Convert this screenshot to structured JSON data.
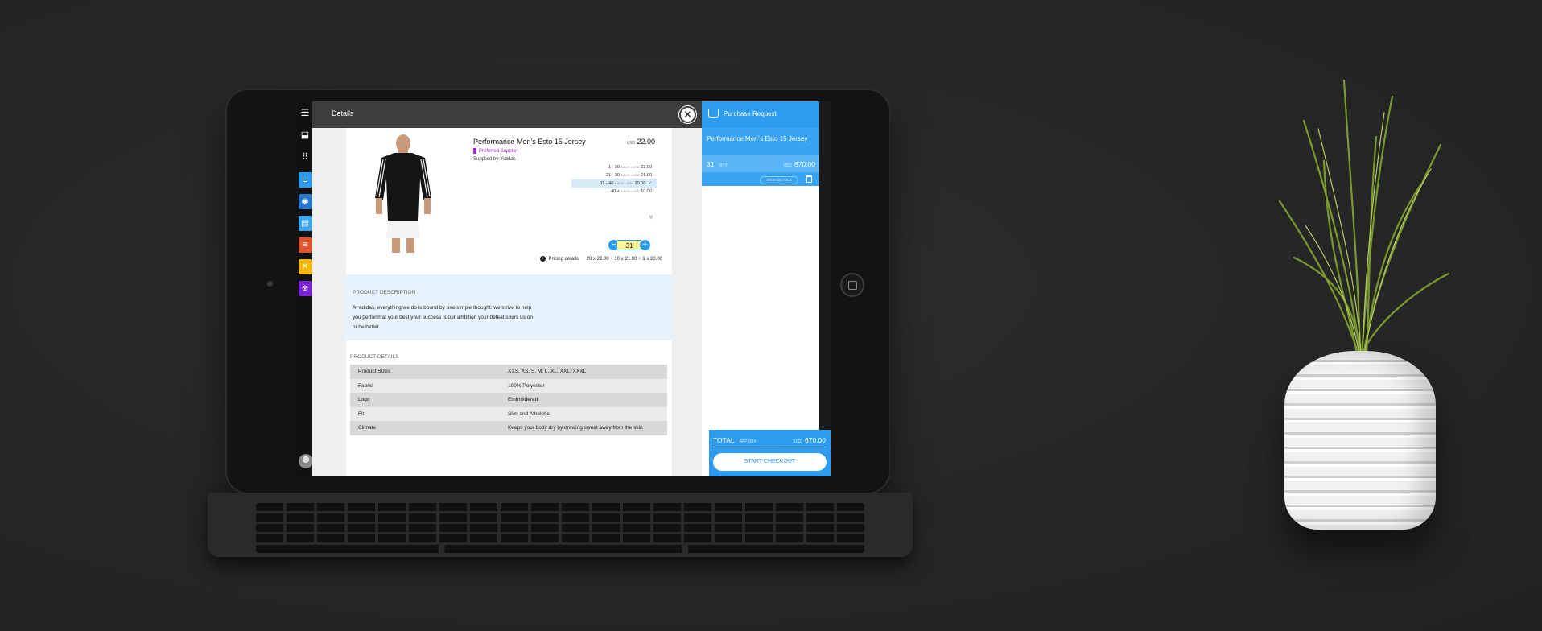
{
  "header": {
    "title": "Details"
  },
  "rail": {
    "items": [
      {
        "name": "menu-icon",
        "color": "#111111",
        "glyph": "☰"
      },
      {
        "name": "inbox-icon",
        "color": "#111111",
        "glyph": "⬓"
      },
      {
        "name": "apps-grid-icon",
        "color": "#111111",
        "glyph": "⠿"
      },
      {
        "name": "cart-icon",
        "color": "#2d9cf0",
        "glyph": "🛒"
      },
      {
        "name": "globe-icon",
        "color": "#2577c9",
        "glyph": "◉"
      },
      {
        "name": "document-icon",
        "color": "#3aa7f2",
        "glyph": "▤"
      },
      {
        "name": "layers-icon",
        "color": "#e0532c",
        "glyph": "≋"
      },
      {
        "name": "tools-icon",
        "color": "#f5b800",
        "glyph": "✕"
      },
      {
        "name": "target-icon",
        "color": "#7b22d6",
        "glyph": "⊕"
      }
    ]
  },
  "product": {
    "title": "Performance Men's Esto 15 Jersey",
    "preferred": "Preferred Supplier",
    "supplied_by": "Supplied by: Adidas",
    "price_currency": "USD",
    "price": "22.00",
    "tiers": [
      {
        "range": "1 - 20",
        "unit": "EACH • USD",
        "price": "22.00",
        "selected": false
      },
      {
        "range": "21 - 30",
        "unit": "EACH • USD",
        "price": "21.00",
        "selected": false
      },
      {
        "range": "31 - 40",
        "unit": "EACH • USD",
        "price": "20.00",
        "selected": true
      },
      {
        "range": "40 +",
        "unit": "EACH • USD",
        "price": "10.00",
        "selected": false
      }
    ],
    "quantity": "31",
    "pricing_label": "Pricing details:",
    "pricing_value": "20 x 22.00 + 10 x 21.00 + 1 x 20.00"
  },
  "description": {
    "heading": "PRODUCT DESCRIPTION",
    "text": "At adidas, everything we do is bound by one simple thought: we strive to help you perform at your best your success is our ambition your defeat spurs us on to be better."
  },
  "details": {
    "heading": "PRODUCT DETAILS",
    "rows": [
      {
        "key": "Product Sizes",
        "value": "XXS, XS, S, M, L, XL, XXL, XXXL"
      },
      {
        "key": "Fabric",
        "value": "100% Polyester"
      },
      {
        "key": "Logo",
        "value": "Embroidered"
      },
      {
        "key": "Fit",
        "value": "Slim and Atheletic"
      },
      {
        "key": "Climate",
        "value": "Keeps your body dry by drawing sweat away from the skin"
      }
    ]
  },
  "purchase_request": {
    "title": "Purchase Request",
    "item_name": "Performance Men´s Esto 15 Jersey",
    "item_qty": "31",
    "item_qty_unit": "QTY",
    "item_currency": "USD",
    "item_amount": "670.00",
    "view_details": "VIEW DETAILS",
    "total_label": "TOTAL",
    "total_approx": "APPROX",
    "total_currency": "USD",
    "total_amount": "670.00",
    "checkout": "START CHECKOUT"
  },
  "colors": {
    "accent": "#2d9cf0",
    "preferred": "#9b27d6",
    "highlight_qty": "#fff69c"
  }
}
